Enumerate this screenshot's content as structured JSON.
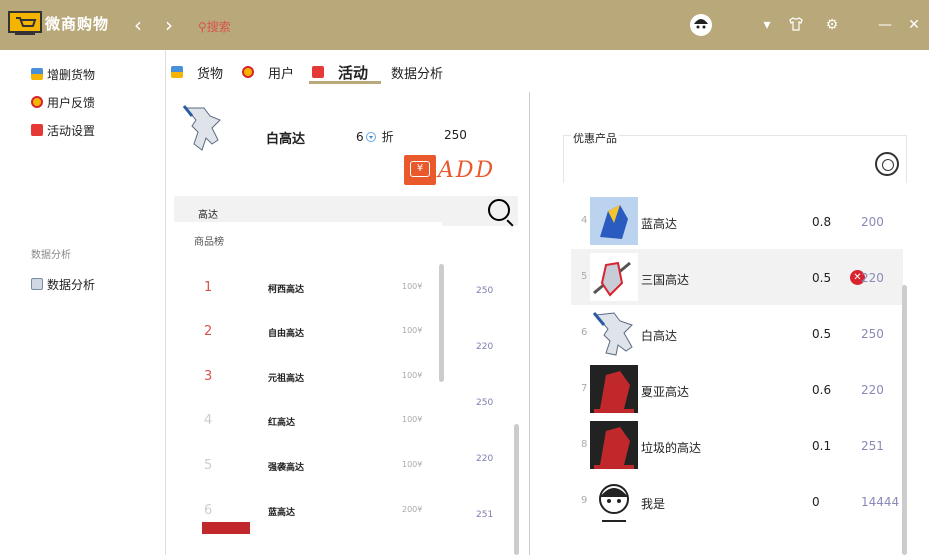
{
  "app": {
    "title": "微商购物",
    "search_label": "搜索"
  },
  "sidebar": {
    "items": [
      {
        "label": "增删货物",
        "icon": "cart-edit-icon"
      },
      {
        "label": "用户反馈",
        "icon": "headset-icon"
      },
      {
        "label": "活动设置",
        "icon": "gift-icon"
      }
    ],
    "group_label": "数据分析",
    "group_items": [
      {
        "label": "数据分析",
        "icon": "chart-icon"
      }
    ]
  },
  "tabs": [
    {
      "label": "货物"
    },
    {
      "label": "用户"
    },
    {
      "label": "活动"
    },
    {
      "label": "数据分析"
    }
  ],
  "editor": {
    "name": "白高达",
    "discount_value": "6",
    "discount_unit": "折",
    "price": "250",
    "add_label": "ADD"
  },
  "search": {
    "value": "高达"
  },
  "rank_list": {
    "header": "商品榜",
    "rows": [
      {
        "rank": "1",
        "name": "柯西高达",
        "price": "100¥"
      },
      {
        "rank": "2",
        "name": "自由高达",
        "price": "100¥"
      },
      {
        "rank": "3",
        "name": "元祖高达",
        "price": "100¥"
      },
      {
        "rank": "4",
        "name": "红高达",
        "price": "100¥"
      },
      {
        "rank": "5",
        "name": "强袭高达",
        "price": "100¥"
      },
      {
        "rank": "6",
        "name": "蓝高达",
        "price": "200¥"
      }
    ],
    "side_values": [
      "250",
      "220",
      "250",
      "220",
      "251"
    ]
  },
  "promo": {
    "title": "优惠产品",
    "rows": [
      {
        "idx": "4",
        "name": "蓝高达",
        "discount": "0.8",
        "price": "200"
      },
      {
        "idx": "5",
        "name": "三国高达",
        "discount": "0.5",
        "price": "220"
      },
      {
        "idx": "6",
        "name": "白高达",
        "discount": "0.5",
        "price": "250"
      },
      {
        "idx": "7",
        "name": "夏亚高达",
        "discount": "0.6",
        "price": "220"
      },
      {
        "idx": "8",
        "name": "垃圾的高达",
        "discount": "0.1",
        "price": "251"
      },
      {
        "idx": "9",
        "name": "我是",
        "discount": "0",
        "price": "14444"
      }
    ]
  },
  "colors": {
    "titlebar": "#b8a87a",
    "accent": "#e9592c",
    "rank_top": "#d9534f"
  }
}
